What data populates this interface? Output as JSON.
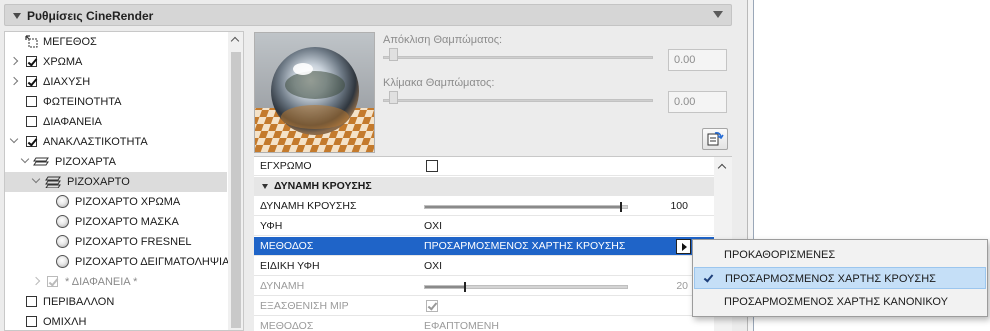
{
  "panel": {
    "title": "Ρυθμίσεις CineRender"
  },
  "tree": {
    "items": [
      {
        "label": "ΜΕΓΕΘΟΣ"
      },
      {
        "label": "ΧΡΩΜΑ"
      },
      {
        "label": "ΔΙΑΧΥΣΗ"
      },
      {
        "label": "ΦΩΤΕΙΝΟΤΗΤΑ"
      },
      {
        "label": "ΔΙΑΦΑΝΕΙΑ"
      },
      {
        "label": "ΑΝΑΚΛΑΣΤΙΚΟΤΗΤΑ"
      },
      {
        "label": "ΡΙΖΟΧΑΡΤΑ"
      },
      {
        "label": "ΡΙΖΟΧΑΡΤΟ"
      },
      {
        "label": "ΡΙΖΟΧΑΡΤΟ ΧΡΩΜΑ"
      },
      {
        "label": "ΡΙΖΟΧΑΡΤΟ ΜΑΣΚΑ"
      },
      {
        "label": "ΡΙΖΟΧΑΡΤΟ FRESNEL"
      },
      {
        "label": "ΡΙΖΟΧΑΡΤΟ ΔΕΙΓΜΑΤΟΛΗΨΙΑ"
      },
      {
        "label": "* ΔΙΑΦΑΝΕΙΑ *"
      },
      {
        "label": "ΠΕΡΙΒΑΛΛΟΝ"
      },
      {
        "label": "ΟΜΙΧΛΗ"
      }
    ]
  },
  "preview": {
    "dimming_label": "Απόκλιση Θαμπώματος:",
    "dimming_value": "0.00",
    "scale_label": "Κλίμακα Θαμπώματος:",
    "scale_value": "0.00"
  },
  "properties": {
    "grayscale_key": "ΕΓΧΡΩΜΟ",
    "section_title": "ΔΥΝΑΜΗ ΚΡΟΥΣΗΣ",
    "strength_key": "ΔΥΝΑΜΗ ΚΡΟΥΣΗΣ",
    "strength_value": "100",
    "strength_fraction": 0.97,
    "texture_key": "ΥΦΗ",
    "texture_value": "ΟΧΙ",
    "method_key": "ΜΕΘΟΔΟΣ",
    "method_value": "ΠΡΟΣΑΡΜΟΣΜΕΝΟΣ ΧΑΡΤΗΣ ΚΡΟΥΣΗΣ",
    "special_texture_key": "ΕΙΔΙΚΗ ΥΦΗ",
    "special_texture_value": "ΟΧΙ",
    "power_key": "ΔΥΝΑΜΗ",
    "power_value": "20",
    "power_fraction": 0.2,
    "mip_key": "ΕΞΑΣΘΕΝΙΣΗ MIP",
    "method2_key": "ΜΕΘΟΔΟΣ",
    "method2_value": "ΕΦΑΠΤΟΜΕΝΗ"
  },
  "menu": {
    "items": [
      {
        "label": "ΠΡΟΚΑΘΟΡΙΣΜΕΝΕΣ"
      },
      {
        "label": "ΠΡΟΣΑΡΜΟΣΜΕΝΟΣ ΧΑΡΤΗΣ ΚΡΟΥΣΗΣ"
      },
      {
        "label": "ΠΡΟΣΑΡΜΟΣΜΕΝΟΣ ΧΑΡΤΗΣ ΚΑΝΟΝΙΚΟΥ"
      }
    ]
  },
  "colors": {
    "selection_blue": "#1f64c8",
    "menu_highlight": "#c5dff7"
  }
}
